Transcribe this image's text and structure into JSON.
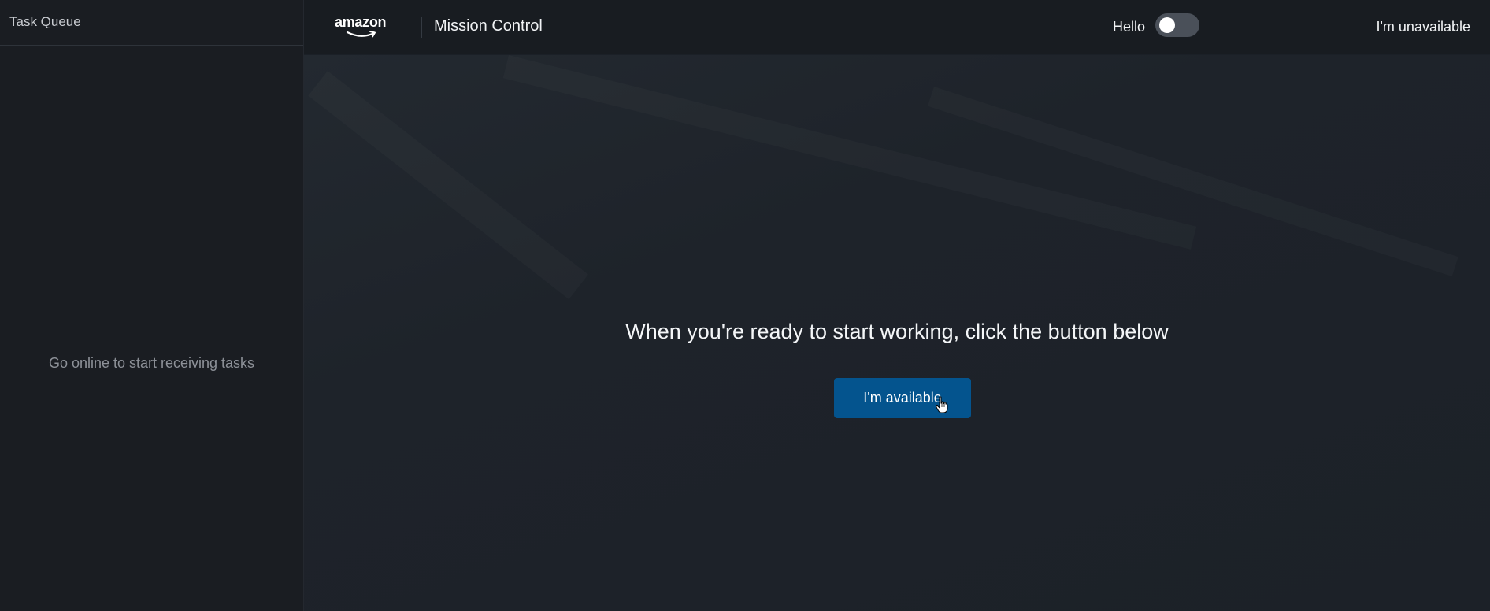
{
  "sidebar": {
    "title": "Task Queue",
    "empty_message": "Go online to start receiving tasks"
  },
  "header": {
    "logo_text": "amazon",
    "app_title": "Mission Control",
    "greeting": "Hello",
    "availability_toggle": {
      "on": false
    },
    "status_label": "I'm unavailable"
  },
  "main": {
    "message": "When you're ready to start working, click the button below",
    "available_button_label": "I'm available"
  },
  "colors": {
    "accent": "#04548e",
    "background": "#1b2027"
  },
  "icons": {
    "logo_smile": "amazon-smile-arrow",
    "cursor": "hand-pointer-cursor"
  }
}
